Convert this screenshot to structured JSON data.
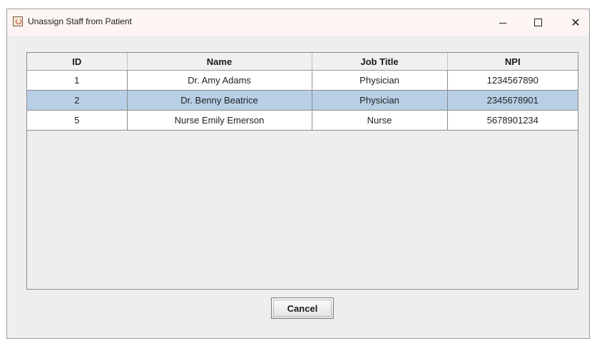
{
  "window": {
    "title": "Unassign Staff from Patient",
    "icon": "java-app-icon",
    "controls": {
      "minimize": "minimize-icon",
      "maximize": "maximize-icon",
      "close_glyph": "✕"
    }
  },
  "table": {
    "columns": [
      "ID",
      "Name",
      "Job Title",
      "NPI"
    ],
    "rows": [
      {
        "id": "1",
        "name": "Dr. Amy Adams",
        "job_title": "Physician",
        "npi": "1234567890",
        "selected": false
      },
      {
        "id": "2",
        "name": "Dr. Benny Beatrice",
        "job_title": "Physician",
        "npi": "2345678901",
        "selected": true
      },
      {
        "id": "5",
        "name": "Nurse Emily Emerson",
        "job_title": "Nurse",
        "npi": "5678901234",
        "selected": false
      }
    ],
    "selection_color": "#b8cfe6"
  },
  "buttons": {
    "cancel": "Cancel"
  }
}
